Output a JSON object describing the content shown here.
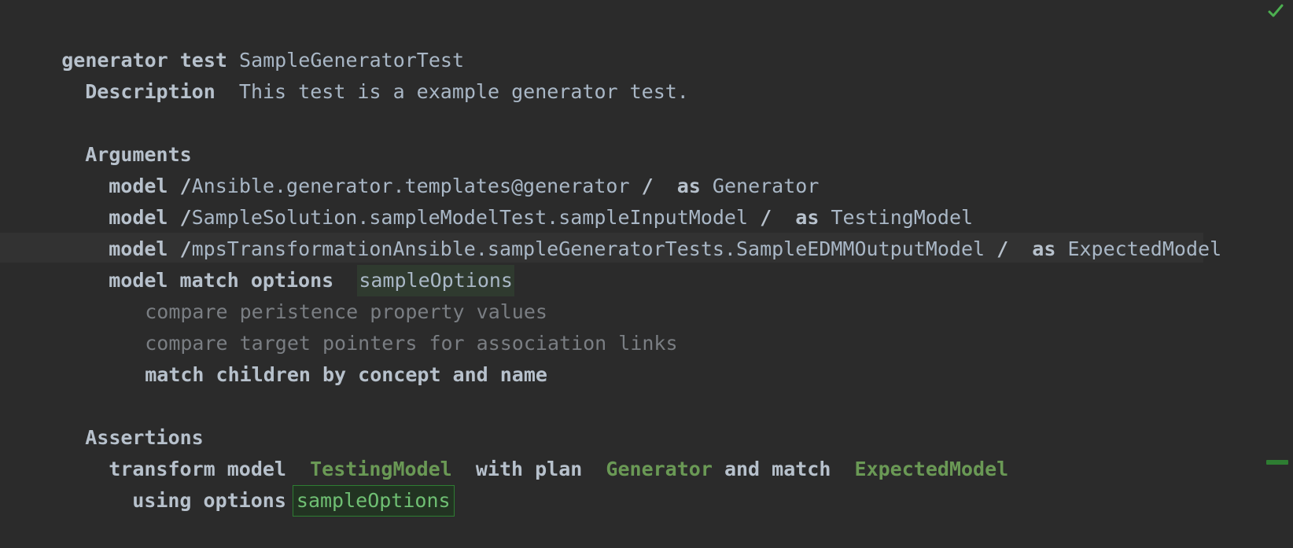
{
  "header": {
    "kw_generator": "generator",
    "kw_test": "test",
    "title": "SampleGeneratorTest"
  },
  "description": {
    "label": "Description",
    "text": "This test is a example generator test."
  },
  "arguments": {
    "label": "Arguments",
    "models": [
      {
        "kw": "model",
        "slash": "/",
        "path": "Ansible.generator.templates@generator",
        "sep": "/",
        "as": "as",
        "alias": "Generator"
      },
      {
        "kw": "model",
        "slash": "/",
        "path": "SampleSolution.sampleModelTest.sampleInputModel",
        "sep": "/",
        "as": "as",
        "alias": "TestingModel"
      },
      {
        "kw": "model",
        "slash": "/",
        "path": "mpsTransformationAnsible.sampleGeneratorTests.SampleEDMMOutputModel",
        "sep": "/",
        "as": "as",
        "alias": "ExpectedModel"
      }
    ],
    "match_options": {
      "label": "model match options",
      "name": "sampleOptions",
      "options": [
        "compare peristence property values",
        "compare target pointers for association links",
        "match children by concept and name"
      ]
    }
  },
  "assertions": {
    "label": "Assertions",
    "transform": {
      "kw_transform": "transform model",
      "input": "TestingModel",
      "kw_with": "with plan",
      "plan": "Generator",
      "kw_match": "and match",
      "expected": "ExpectedModel",
      "kw_using": "using options",
      "options_ref": "sampleOptions"
    }
  },
  "colors": {
    "background": "#2b2b2b",
    "keyword": "#b7c1cc",
    "reference_green": "#6a9955",
    "muted": "#7a7e83",
    "check": "#4caf50"
  },
  "icons": {
    "status": "checkmark-icon",
    "marker": "scroll-marker"
  }
}
